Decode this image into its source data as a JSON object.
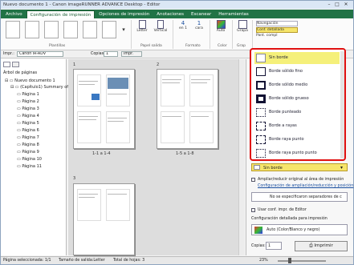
{
  "window": {
    "title": "Nuevo documento 1 - Canon imageRUNNER ADVANCE Desktop - Editor"
  },
  "tabs": [
    "Archivo",
    "Configuración de impresión",
    "Opciones de impresión",
    "Anotaciones",
    "Escanear",
    "Herramientas"
  ],
  "ribbon": {
    "plantillas_label": "Plantillas",
    "paper_letter": "Letter",
    "paper_vertical": "Vertical",
    "papel_salida_label": "Papel salida",
    "nup_value": "4",
    "nup_label": "en 1",
    "copies_value": "1",
    "copies_label": "cara",
    "formato_label": "Formato",
    "color_value": "Auto",
    "color_group": "Color",
    "grapa": "Grapa",
    "grapa_group": "Grap",
    "navegacion": "Navegación",
    "conf_detallada": "Conf. detallada",
    "pant_compl": "Pant. compl"
  },
  "toolbar": {
    "printer_label": "Impr.:",
    "printer_value": "Canon iR-ADV",
    "copies_label": "Copias:",
    "copies_value": "1",
    "print_button": "Impr."
  },
  "tree": {
    "header": "Árbol de páginas",
    "root": "Nuevo documento 1",
    "chapter": "(Capítulo1) Summary of P",
    "pages": [
      "Página 1",
      "Página 2",
      "Página 3",
      "Página 4",
      "Página 5",
      "Página 6",
      "Página 7",
      "Página 8",
      "Página 9",
      "Página 10",
      "Página 11"
    ]
  },
  "center": {
    "group1": "1",
    "group2": "2",
    "group3": "3",
    "label1": "1-1 a 1-4",
    "label2": "1-5 a 1-8"
  },
  "border_dropdown": {
    "items": [
      "Sin borde",
      "Borde sólido fino",
      "Borde sólido medio",
      "Borde sólido grueso",
      "Borde punteado",
      "Borde a rayas",
      "Borde raya punto",
      "Borde raya punto punto"
    ],
    "selected": "Sin borde"
  },
  "right_panel": {
    "border_value": "Sin borde",
    "reduce_option": "Ampliar/reducir original al área de impresión",
    "reduce_link": "Configuración de ampliación/reducción y posición",
    "separator_option": "No se especificaron separadores de c",
    "use_editor_settings": "Usar conf. impr. de Editor",
    "detailed_config": "Configuración detallada para impresión",
    "color_mode": "Auto (Color/Blanco y negro)",
    "copies_label": "Copias:",
    "copies_value": "1",
    "print_button": "Imprimir"
  },
  "status": {
    "selected": "Página seleccionada: 1/1",
    "output_size": "Tamaño de salida:Letter",
    "total": "Total de hojas: 3",
    "zoom": "23%"
  },
  "colors": {
    "accent": "#217346",
    "highlight": "#e01111",
    "selected_item": "#f5f07a"
  }
}
